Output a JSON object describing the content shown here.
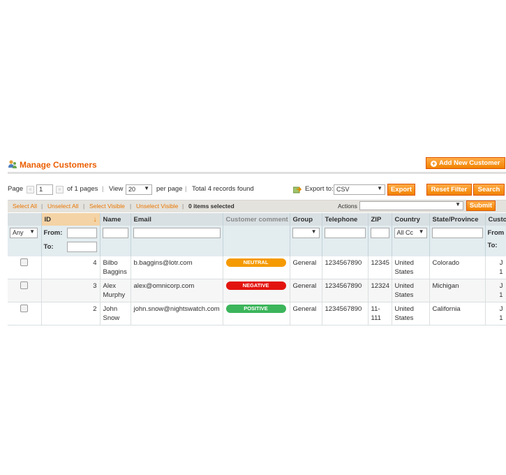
{
  "header": {
    "title": "Manage Customers",
    "add_button": "Add New Customer",
    "plus_glyph": "+"
  },
  "pager": {
    "page_label": "Page",
    "page_value": "1",
    "of_pages": "of 1 pages",
    "view_label": "View",
    "per_page_value": "20",
    "per_page_label": "per page",
    "total": "Total 4 records found",
    "sep": "|"
  },
  "export": {
    "label": "Export to:",
    "format": "CSV",
    "button": "Export"
  },
  "buttons": {
    "reset": "Reset Filter",
    "search": "Search",
    "submit": "Submit"
  },
  "massaction": {
    "select_all": "Select All",
    "unselect_all": "Unselect All",
    "select_visible": "Select Visible",
    "unselect_visible": "Unselect Visible",
    "selected": "0 items selected",
    "actions_label": "Actions",
    "sep": "|"
  },
  "columns": {
    "id": "ID",
    "name": "Name",
    "email": "Email",
    "comment": "Customer comment",
    "group": "Group",
    "telephone": "Telephone",
    "zip": "ZIP",
    "country": "Country",
    "state": "State/Province",
    "since": "Custo"
  },
  "filters": {
    "any": "Any",
    "from": "From:",
    "to": "To:",
    "country": "All Cc",
    "since_from": "From",
    "since_to": "To:"
  },
  "rows": [
    {
      "id": "4",
      "first": "Bilbo",
      "last": "Baggins",
      "email": "b.baggins@lotr.com",
      "comment": "NEUTRAL",
      "comment_color": "#f59a00",
      "group": "General",
      "telephone": "1234567890",
      "zip1": "12345",
      "zip2": "",
      "country1": "United",
      "country2": "States",
      "state": "Colorado",
      "since1": "J",
      "since2": "1"
    },
    {
      "id": "3",
      "first": "Alex",
      "last": "Murphy",
      "email": "alex@omnicorp.com",
      "comment": "NEGATIVE",
      "comment_color": "#e3140f",
      "group": "General",
      "telephone": "1234567890",
      "zip1": "12324",
      "zip2": "",
      "country1": "United",
      "country2": "States",
      "state": "Michigan",
      "since1": "J",
      "since2": "1"
    },
    {
      "id": "2",
      "first": "John",
      "last": "Snow",
      "email": "john.snow@nightswatch.com",
      "comment": "POSITIVE",
      "comment_color": "#3cb55b",
      "group": "General",
      "telephone": "1234567890",
      "zip1": "11-",
      "zip2": "111",
      "country1": "United",
      "country2": "States",
      "state": "California",
      "since1": "J",
      "since2": "1"
    }
  ],
  "colors": {
    "accent": "#eb5e00",
    "button": "#f18200",
    "link": "#ea7601"
  },
  "icons": {
    "title": "customers-icon",
    "export": "export-icon",
    "sort": "sort-down-arrow-icon"
  },
  "glyphs": {
    "caret": "▼",
    "prev": "«",
    "next": "»",
    "sort": "↓"
  }
}
